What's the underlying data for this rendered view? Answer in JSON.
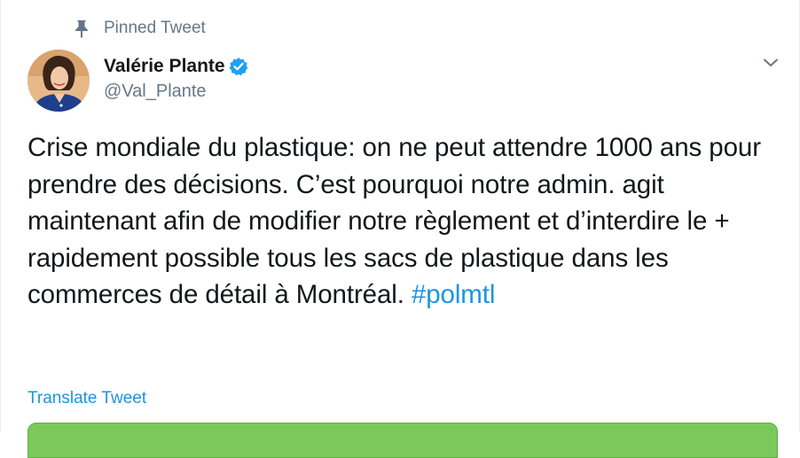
{
  "pinned": {
    "label": "Pinned Tweet",
    "icon": "pin-icon"
  },
  "author": {
    "name": "Valérie Plante",
    "handle": "@Val_Plante",
    "verified": true,
    "verified_icon": "verified-badge-icon",
    "verified_color": "#1da1f2",
    "avatar_icon": "avatar"
  },
  "menu": {
    "icon": "chevron-down-icon"
  },
  "tweet": {
    "text": "Crise mondiale du plastique: on ne peut attendre 1000 ans pour prendre des décisions. C’est pourquoi notre admin. agit maintenant afin de modifier notre règlement et d’interdire le + rapidement possible tous les sacs de plastique dans les commerces de détail à Montréal. ",
    "hashtag": "#polmtl",
    "hashtag_color": "#1b95e0"
  },
  "translate": {
    "label": "Translate Tweet"
  },
  "colors": {
    "text": "#14171a",
    "secondary": "#657786",
    "link": "#1b95e0",
    "media_green": "#7cc95b"
  }
}
